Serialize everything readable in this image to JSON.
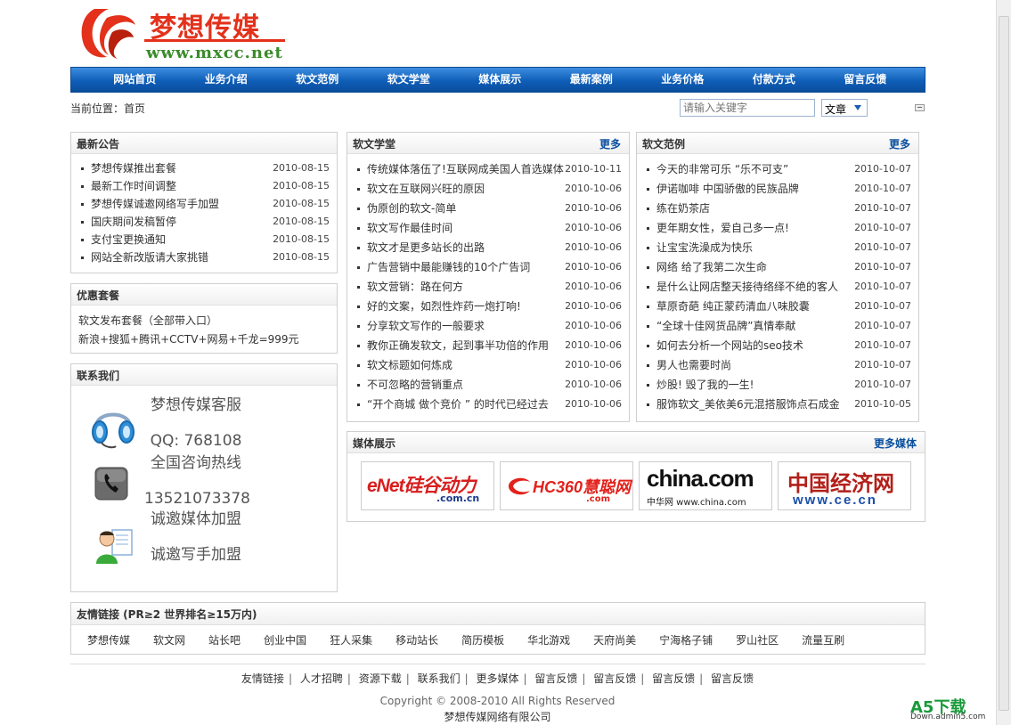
{
  "logo": {
    "cn": "梦想传媒",
    "url": "www.mxcc.net"
  },
  "nav": [
    "网站首页",
    "业务介绍",
    "软文范例",
    "软文学堂",
    "媒体展示",
    "最新案例",
    "业务价格",
    "付款方式",
    "留言反馈"
  ],
  "breadcrumb": "当前位置：首页",
  "search": {
    "placeholder": "请输入关键字",
    "select": "文章"
  },
  "notice": {
    "title": "最新公告",
    "items": [
      {
        "t": "梦想传媒推出套餐",
        "d": "2010-08-15"
      },
      {
        "t": "最新工作时间调整",
        "d": "2010-08-15"
      },
      {
        "t": "梦想传媒诚邀网络写手加盟",
        "d": "2010-08-15"
      },
      {
        "t": "国庆期间发稿暂停",
        "d": "2010-08-15"
      },
      {
        "t": "支付宝更换通知",
        "d": "2010-08-15"
      },
      {
        "t": "网站全新改版请大家挑错",
        "d": "2010-08-15"
      }
    ]
  },
  "package": {
    "title": "优惠套餐",
    "line1": "软文发布套餐（全部带入口）",
    "line2": "新浪+搜狐+腾讯+CCTV+网易+千龙=999元"
  },
  "contact": {
    "title": "联系我们",
    "service_title": "梦想传媒客服",
    "qq": "QQ: 768108",
    "hotline_title": "全国咨询热线",
    "phone": "13521073378",
    "media_join": "诚邀媒体加盟",
    "writer_join": "诚邀写手加盟"
  },
  "school": {
    "title": "软文学堂",
    "more": "更多",
    "items": [
      {
        "t": "传统媒体落伍了!互联网成美国人首选媒体",
        "d": "2010-10-11"
      },
      {
        "t": "软文在互联网兴旺的原因",
        "d": "2010-10-06"
      },
      {
        "t": "伪原创的软文-简单",
        "d": "2010-10-06"
      },
      {
        "t": "软文写作最佳时间",
        "d": "2010-10-06"
      },
      {
        "t": "软文才是更多站长的出路",
        "d": "2010-10-06"
      },
      {
        "t": "广告营销中最能赚钱的10个广告词",
        "d": "2010-10-06"
      },
      {
        "t": "软文营销：路在何方",
        "d": "2010-10-06"
      },
      {
        "t": "好的文案，如烈性炸药一炮打响!",
        "d": "2010-10-06"
      },
      {
        "t": "分享软文写作的一般要求",
        "d": "2010-10-06"
      },
      {
        "t": "教你正确发软文，起到事半功倍的作用",
        "d": "2010-10-06"
      },
      {
        "t": "软文标题如何炼成",
        "d": "2010-10-06"
      },
      {
        "t": "不可忽略的营销重点",
        "d": "2010-10-06"
      },
      {
        "t": "“开个商城 做个竞价 ” 的时代已经过去",
        "d": "2010-10-06"
      }
    ]
  },
  "examples": {
    "title": "软文范例",
    "more": "更多",
    "items": [
      {
        "t": "今天的非常可乐 “乐不可支”",
        "d": "2010-10-07"
      },
      {
        "t": "伊诺咖啡 中国骄傲的民族品牌",
        "d": "2010-10-07"
      },
      {
        "t": "练在奶茶店",
        "d": "2010-10-07"
      },
      {
        "t": "更年期女性，爱自己多一点!",
        "d": "2010-10-07"
      },
      {
        "t": "让宝宝洗澡成为快乐",
        "d": "2010-10-07"
      },
      {
        "t": "网络 给了我第二次生命",
        "d": "2010-10-07"
      },
      {
        "t": "是什么让网店整天接待络绎不绝的客人",
        "d": "2010-10-07"
      },
      {
        "t": "草原奇葩 纯正蒙药清血八味胶囊",
        "d": "2010-10-07"
      },
      {
        "t": "“全球十佳网货品牌”真情奉献",
        "d": "2010-10-07"
      },
      {
        "t": "如何去分析一个网站的seo技术",
        "d": "2010-10-07"
      },
      {
        "t": "男人也需要时尚",
        "d": "2010-10-07"
      },
      {
        "t": "炒股! 毁了我的一生!",
        "d": "2010-10-07"
      },
      {
        "t": "服饰软文_美依美6元混搭服饰点石成金",
        "d": "2010-10-05"
      }
    ]
  },
  "media": {
    "title": "媒体展示",
    "more": "更多媒体",
    "logos": [
      {
        "name": "eNet硅谷动力",
        "sub": ".com.cn"
      },
      {
        "name": "HC360慧聪网",
        "sub": ".com"
      },
      {
        "name": "china.com",
        "sub": "中华网 www.china.com"
      },
      {
        "name": "中国经济网",
        "sub": "www.ce.cn"
      }
    ]
  },
  "links": {
    "title": "友情链接 (PR≥2 世界排名≥15万内)",
    "items": [
      "梦想传媒",
      "软文网",
      "站长吧",
      "创业中国",
      "狂人采集",
      "移动站长",
      "简历模板",
      "华北游戏",
      "天府尚美",
      "宁海格子铺",
      "罗山社区",
      "流量互刷"
    ]
  },
  "footer": {
    "links": [
      "友情链接",
      "人才招聘",
      "资源下载",
      "联系我们",
      "更多媒体",
      "留言反馈",
      "留言反馈",
      "留言反馈",
      "留言反馈"
    ],
    "copyright": "Copyright © 2008-2010 All Rights Reserved",
    "company": "梦想传媒网络有限公司"
  },
  "watermark": {
    "big": "A5下载",
    "small": "Down.admin5.com"
  },
  "colors": {
    "nav": "#0f5eb8",
    "brand_red": "#e3311b",
    "brand_green": "#3a8b2a",
    "more_link": "#0a4f9e"
  }
}
